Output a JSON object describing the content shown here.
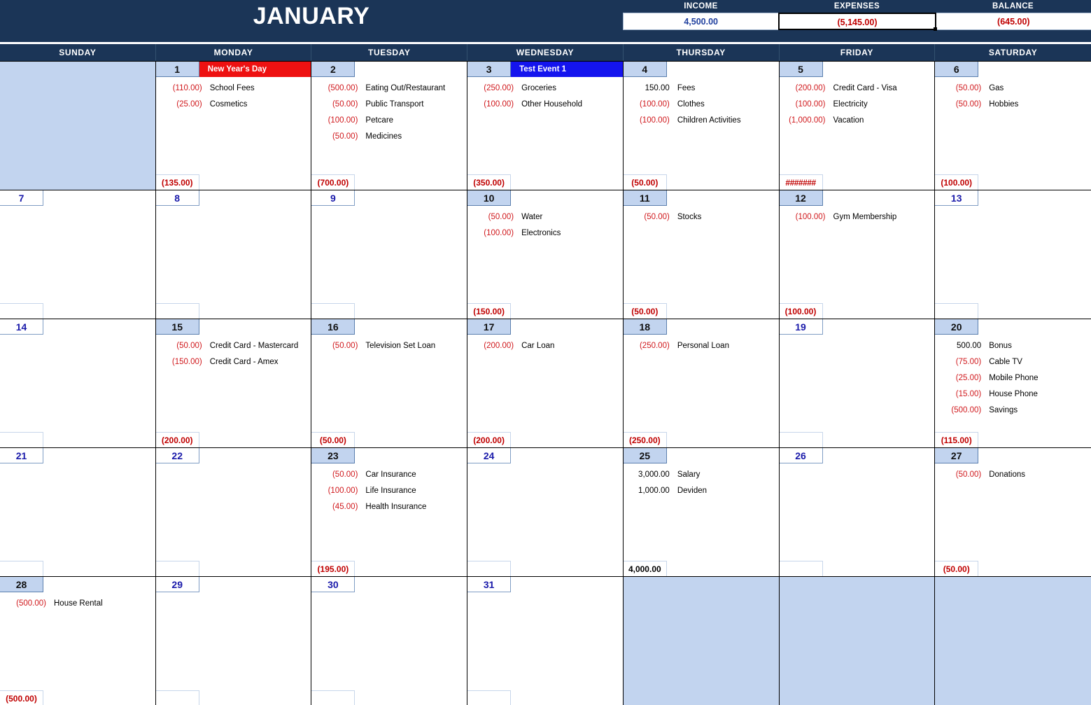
{
  "header": {
    "month_title": "JANUARY",
    "summary": [
      {
        "label": "INCOME",
        "value": "4,500.00",
        "tone": "income"
      },
      {
        "label": "EXPENSES",
        "value": "(5,145.00)",
        "tone": "expenses"
      },
      {
        "label": "BALANCE",
        "value": "(645.00)",
        "tone": "balance"
      }
    ]
  },
  "colors": {
    "header_navy": "#1b3557",
    "shade_blue": "#c2d4ef",
    "negative_red": "#d0181c",
    "total_red": "#c00000",
    "daynum_blue": "#1a1aaa",
    "event_red": "#ee1111",
    "event_blue": "#1414ee"
  },
  "weekdays": [
    "SUNDAY",
    "MONDAY",
    "TUESDAY",
    "WEDNESDAY",
    "THURSDAY",
    "FRIDAY",
    "SATURDAY"
  ],
  "weeks": [
    [
      {
        "filler": true
      },
      {
        "num": "1",
        "event": {
          "label": "New Year's Day",
          "color": "red"
        },
        "items": [
          {
            "amount": "(110.00)",
            "desc": "School Fees"
          },
          {
            "amount": "(25.00)",
            "desc": "Cosmetics"
          }
        ],
        "total": "(135.00)"
      },
      {
        "num": "2",
        "items": [
          {
            "amount": "(500.00)",
            "desc": "Eating Out/Restaurant"
          },
          {
            "amount": "(50.00)",
            "desc": "Public Transport"
          },
          {
            "amount": "(100.00)",
            "desc": "Petcare"
          },
          {
            "amount": "(50.00)",
            "desc": "Medicines"
          }
        ],
        "total": "(700.00)"
      },
      {
        "num": "3",
        "event": {
          "label": "Test Event 1",
          "color": "blue"
        },
        "items": [
          {
            "amount": "(250.00)",
            "desc": "Groceries"
          },
          {
            "amount": "(100.00)",
            "desc": "Other Household"
          }
        ],
        "total": "(350.00)"
      },
      {
        "num": "4",
        "items": [
          {
            "amount": "150.00",
            "desc": "Fees",
            "positive": true
          },
          {
            "amount": "(100.00)",
            "desc": "Clothes"
          },
          {
            "amount": "(100.00)",
            "desc": "Children Activities"
          }
        ],
        "total": "(50.00)"
      },
      {
        "num": "5",
        "items": [
          {
            "amount": "(200.00)",
            "desc": "Credit Card - Visa"
          },
          {
            "amount": "(100.00)",
            "desc": "Electricity"
          },
          {
            "amount": "(1,000.00)",
            "desc": "Vacation"
          }
        ],
        "total": "#######",
        "total_overflow": true
      },
      {
        "num": "6",
        "items": [
          {
            "amount": "(50.00)",
            "desc": "Gas"
          },
          {
            "amount": "(50.00)",
            "desc": "Hobbies"
          }
        ],
        "total": "(100.00)"
      }
    ],
    [
      {
        "num": "7",
        "items": [],
        "total": ""
      },
      {
        "num": "8",
        "items": [],
        "total": ""
      },
      {
        "num": "9",
        "items": [],
        "total": ""
      },
      {
        "num": "10",
        "items": [
          {
            "amount": "(50.00)",
            "desc": "Water"
          },
          {
            "amount": "(100.00)",
            "desc": "Electronics"
          }
        ],
        "total": "(150.00)"
      },
      {
        "num": "11",
        "items": [
          {
            "amount": "(50.00)",
            "desc": "Stocks"
          }
        ],
        "total": "(50.00)"
      },
      {
        "num": "12",
        "items": [
          {
            "amount": "(100.00)",
            "desc": "Gym Membership"
          }
        ],
        "total": "(100.00)"
      },
      {
        "num": "13",
        "items": [],
        "total": ""
      }
    ],
    [
      {
        "num": "14",
        "items": [],
        "total": ""
      },
      {
        "num": "15",
        "items": [
          {
            "amount": "(50.00)",
            "desc": "Credit Card - Mastercard"
          },
          {
            "amount": "(150.00)",
            "desc": "Credit Card - Amex"
          }
        ],
        "total": "(200.00)"
      },
      {
        "num": "16",
        "items": [
          {
            "amount": "(50.00)",
            "desc": "Television Set Loan"
          }
        ],
        "total": "(50.00)"
      },
      {
        "num": "17",
        "items": [
          {
            "amount": "(200.00)",
            "desc": "Car Loan"
          }
        ],
        "total": "(200.00)"
      },
      {
        "num": "18",
        "items": [
          {
            "amount": "(250.00)",
            "desc": "Personal Loan"
          }
        ],
        "total": "(250.00)"
      },
      {
        "num": "19",
        "items": [],
        "total": ""
      },
      {
        "num": "20",
        "items": [
          {
            "amount": "500.00",
            "desc": "Bonus",
            "positive": true
          },
          {
            "amount": "(75.00)",
            "desc": "Cable TV"
          },
          {
            "amount": "(25.00)",
            "desc": "Mobile Phone"
          },
          {
            "amount": "(15.00)",
            "desc": "House Phone"
          },
          {
            "amount": "(500.00)",
            "desc": "Savings"
          }
        ],
        "total": "(115.00)"
      }
    ],
    [
      {
        "num": "21",
        "items": [],
        "total": ""
      },
      {
        "num": "22",
        "items": [],
        "total": ""
      },
      {
        "num": "23",
        "items": [
          {
            "amount": "(50.00)",
            "desc": "Car Insurance"
          },
          {
            "amount": "(100.00)",
            "desc": "Life Insurance"
          },
          {
            "amount": "(45.00)",
            "desc": "Health Insurance"
          }
        ],
        "total": "(195.00)"
      },
      {
        "num": "24",
        "items": [],
        "total": ""
      },
      {
        "num": "25",
        "items": [
          {
            "amount": "3,000.00",
            "desc": "Salary",
            "positive": true
          },
          {
            "amount": "1,000.00",
            "desc": "Deviden",
            "positive": true
          }
        ],
        "total": "4,000.00",
        "total_positive": true
      },
      {
        "num": "26",
        "items": [],
        "total": ""
      },
      {
        "num": "27",
        "items": [
          {
            "amount": "(50.00)",
            "desc": "Donations"
          }
        ],
        "total": "(50.00)"
      }
    ],
    [
      {
        "num": "28",
        "items": [
          {
            "amount": "(500.00)",
            "desc": "House Rental"
          }
        ],
        "total": "(500.00)"
      },
      {
        "num": "29",
        "items": [],
        "total": ""
      },
      {
        "num": "30",
        "items": [],
        "total": ""
      },
      {
        "num": "31",
        "items": [],
        "total": ""
      },
      {
        "filler": true
      },
      {
        "filler": true
      },
      {
        "filler": true
      }
    ]
  ]
}
